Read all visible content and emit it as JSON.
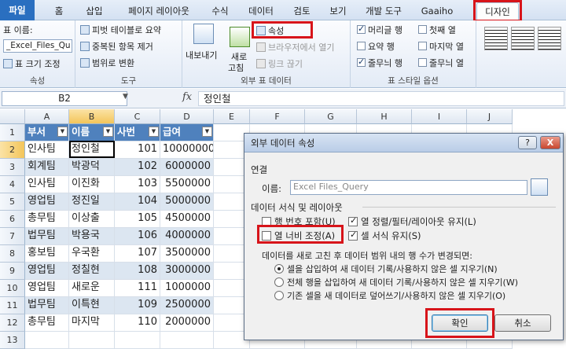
{
  "tabs": [
    "파일",
    "홈",
    "삽입",
    "페이지 레이아웃",
    "수식",
    "데이터",
    "검토",
    "보기",
    "개발 도구",
    "Gaaiho",
    "디자인"
  ],
  "ribbon": {
    "properties": {
      "table_name_label": "표 이름:",
      "table_name_value": "_Excel_Files_Qu",
      "resize_label": "표 크기 조정",
      "group_label": "속성"
    },
    "tools": {
      "pivot_label": "피벗 테이블로 요약",
      "remove_dup_label": "중복된 항목 제거",
      "convert_label": "범위로 변환",
      "group_label": "도구"
    },
    "external": {
      "export_label": "내보내기",
      "refresh_label_1": "새로",
      "refresh_label_2": "고침",
      "properties_label": "속성",
      "open_browser_label": "브라우저에서 열기",
      "unlink_label": "링크 끊기",
      "group_label": "외부 표 데이터"
    },
    "style_options": {
      "header_row": "머리글 행",
      "total_row": "요약 행",
      "banded_rows": "줄무늬 행",
      "first_col": "첫째 열",
      "last_col": "마지막 열",
      "banded_cols": "줄무늬 열",
      "group_label": "표 스타일 옵션"
    }
  },
  "formula_bar": {
    "name_box": "B2",
    "fx": "fx",
    "value": "정인철"
  },
  "grid": {
    "columns": [
      "A",
      "B",
      "C",
      "D",
      "E",
      "F",
      "G",
      "H",
      "I",
      "J"
    ],
    "rows": [
      "1",
      "2",
      "3",
      "4",
      "5",
      "6",
      "7",
      "8",
      "9",
      "10",
      "11",
      "12",
      "13"
    ],
    "headers": [
      "부서",
      "이름",
      "사번",
      "급여"
    ],
    "data": [
      [
        "인사팀",
        "정인철",
        "101",
        "10000000"
      ],
      [
        "회계팀",
        "박광덕",
        "102",
        "6000000"
      ],
      [
        "인사팀",
        "이진화",
        "103",
        "5500000"
      ],
      [
        "영업팀",
        "정진일",
        "104",
        "5000000"
      ],
      [
        "총무팀",
        "이상출",
        "105",
        "4500000"
      ],
      [
        "법무팀",
        "박용국",
        "106",
        "4000000"
      ],
      [
        "홍보팀",
        "우국환",
        "107",
        "3500000"
      ],
      [
        "영업팀",
        "정칠현",
        "108",
        "3000000"
      ],
      [
        "영업팀",
        "새로운",
        "111",
        "1000000"
      ],
      [
        "법무팀",
        "이특현",
        "109",
        "2500000"
      ],
      [
        "총무팀",
        "마지막",
        "110",
        "2000000"
      ]
    ]
  },
  "dialog": {
    "title": "외부 데이터 속성",
    "help_btn": "?",
    "close_btn": "X",
    "connection_label": "연결",
    "name_label": "이름:",
    "name_value": "Excel Files_Query",
    "format_label": "데이터 서식 및 레이아웃",
    "row_numbers": "행 번호 포함(U)",
    "preserve_sort": "열 정렬/필터/레이아웃 유지(L)",
    "adjust_width": "열 너비 조정(A)",
    "preserve_format": "셀 서식 유지(S)",
    "refresh_rule": "데이터를 새로 고친 후 데이터 범위 내의 행 수가  변경되면:",
    "radio1": "셀을 삽입하여 새 데이터 기록/사용하지 않은 셀 지우기(N)",
    "radio2": "전체 행을 삽입하여 새 데이터 기록/사용하지 않은 셀 지우기(W)",
    "radio3": "기존 셀을 새 데이터로 덮어쓰기/사용하지 않은 셀 지우기(O)",
    "ok_label": "확인",
    "cancel_label": "취소"
  }
}
